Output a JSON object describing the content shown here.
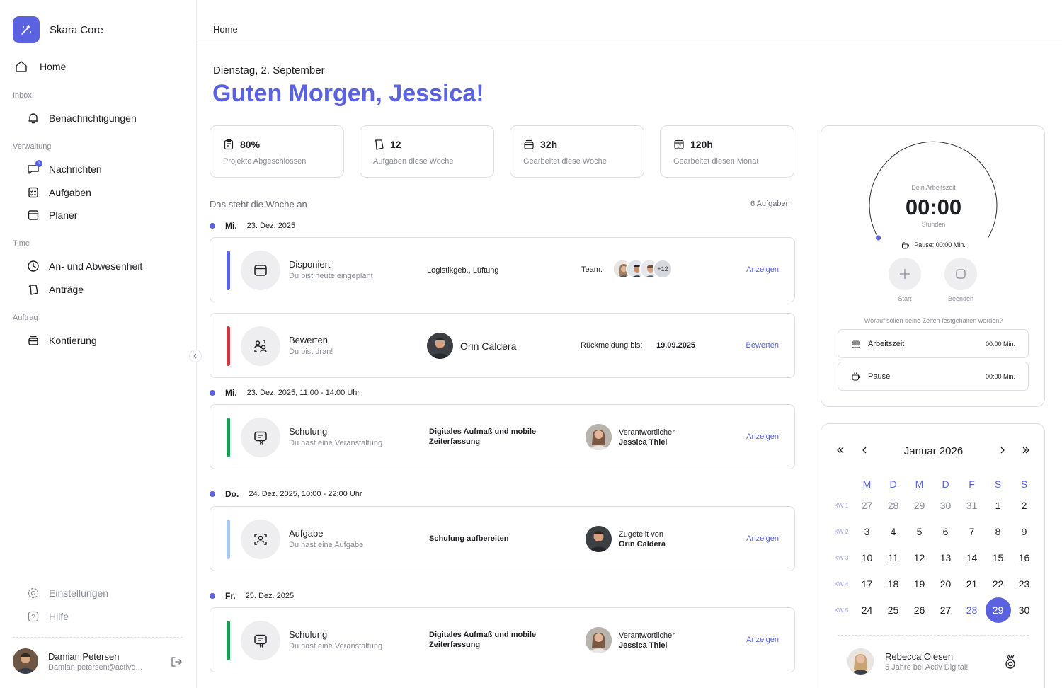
{
  "app": {
    "name": "Skara Core"
  },
  "sidebar": {
    "home": "Home",
    "sections": {
      "inbox": "Inbox",
      "verwaltung": "Verwaltung",
      "time": "Time",
      "auftrag": "Auftrag"
    },
    "items": {
      "benachrichtigungen": "Benachrichtigungen",
      "nachrichten": "Nachrichten",
      "nachrichten_badge": "1",
      "aufgaben": "Aufgaben",
      "planer": "Planer",
      "anwesenheit": "An- und Abwesenheit",
      "antraege": "Anträge",
      "kontierung": "Kontierung",
      "einstellungen": "Einstellungen",
      "hilfe": "Hilfe"
    },
    "user": {
      "name": "Damian Petersen",
      "email": "Damian.petersen@activd..."
    }
  },
  "header": {
    "breadcrumb": "Home"
  },
  "hero": {
    "date": "Dienstag, 2. September",
    "greeting": "Guten Morgen, Jessica!"
  },
  "stats": [
    {
      "value": "80%",
      "label": "Projekte Abgeschlossen",
      "icon": "clipboard-icon"
    },
    {
      "value": "12",
      "label": "Aufgaben diese Woche",
      "icon": "tasks-icon"
    },
    {
      "value": "32h",
      "label": "Gearbeitet diese Woche",
      "icon": "briefcase-icon"
    },
    {
      "value": "120h",
      "label": "Gearbeitet diesen Monat",
      "icon": "calendar-icon"
    }
  ],
  "week": {
    "title": "Das steht die Woche an",
    "count": "6 Aufgaben",
    "days": [
      {
        "name": "Mi.",
        "date": "23. Dez. 2025"
      },
      {
        "name": "Mi.",
        "date": "23. Dez. 2025, 11:00 - 14:00 Uhr"
      },
      {
        "name": "Do.",
        "date": "24. Dez. 2025, 10:00 - 22:00 Uhr"
      },
      {
        "name": "Fr.",
        "date": "25. Dez. 2025"
      }
    ],
    "cards": [
      {
        "title": "Disponiert",
        "sub": "Du bist heute eingeplant",
        "mid": "Logistikgeb., Lüftung",
        "team_label": "Team:",
        "team_more": "+12",
        "link": "Anzeigen",
        "color": "#5b62e0"
      },
      {
        "title": "Bewerten",
        "sub": "Du bist dran!",
        "person": "Orin Caldera",
        "deadline_label": "Rückmeldung bis:",
        "deadline": "19.09.2025",
        "link": "Bewerten",
        "color": "#c53a45"
      },
      {
        "title": "Schulung",
        "sub": "Du hast eine Veranstaltung",
        "mid1": "Digitales Aufmaß und mobile",
        "mid2": "Zeiterfassung",
        "role": "Verantwortlicher",
        "person": "Jessica Thiel",
        "link": "Anzeigen",
        "color": "#1f9a55"
      },
      {
        "title": "Aufgabe",
        "sub": "Du hast eine Aufgabe",
        "mid": "Schulung aufbereiten",
        "role": "Zugeteilt von",
        "person": "Orin Caldera",
        "link": "Anzeigen",
        "color": "#a8c8ee"
      },
      {
        "title": "Schulung",
        "sub": "Du hast eine Veranstaltung",
        "mid1": "Digitales Aufmaß und mobile",
        "mid2": "Zeiterfassung",
        "role": "Verantwortlicher",
        "person": "Jessica Thiel",
        "link": "Anzeigen",
        "color": "#1f9a55"
      }
    ]
  },
  "timer": {
    "label": "Dein Arbeitszeit",
    "value": "00:00",
    "unit": "Stunden",
    "pause": "Pause: 00:00 Min.",
    "start": "Start",
    "end": "Beenden",
    "question": "Worauf sollen deine Zeiten festgehalten werden?",
    "slots": [
      {
        "name": "Arbeitszeit",
        "value": "00:00 Min."
      },
      {
        "name": "Pause",
        "value": "00:00 Min."
      }
    ]
  },
  "calendar": {
    "month": "Januar 2026",
    "weekdays": [
      "M",
      "D",
      "M",
      "D",
      "F",
      "S",
      "S"
    ],
    "weeks": [
      {
        "kw": "KW 1",
        "days": [
          "27",
          "28",
          "29",
          "30",
          "31",
          "1",
          "2"
        ]
      },
      {
        "kw": "KW 2",
        "days": [
          "3",
          "4",
          "5",
          "6",
          "7",
          "8",
          "9"
        ]
      },
      {
        "kw": "KW 3",
        "days": [
          "10",
          "11",
          "12",
          "13",
          "14",
          "15",
          "16"
        ]
      },
      {
        "kw": "KW 4",
        "days": [
          "17",
          "18",
          "19",
          "20",
          "21",
          "22",
          "23"
        ]
      },
      {
        "kw": "KW 5",
        "days": [
          "24",
          "25",
          "26",
          "27",
          "28",
          "29",
          "30"
        ]
      }
    ],
    "selected": "29",
    "today": "28"
  },
  "anniversary": {
    "name": "Rebecca Olesen",
    "text": "5 Jahre bei Activ Digital!"
  }
}
